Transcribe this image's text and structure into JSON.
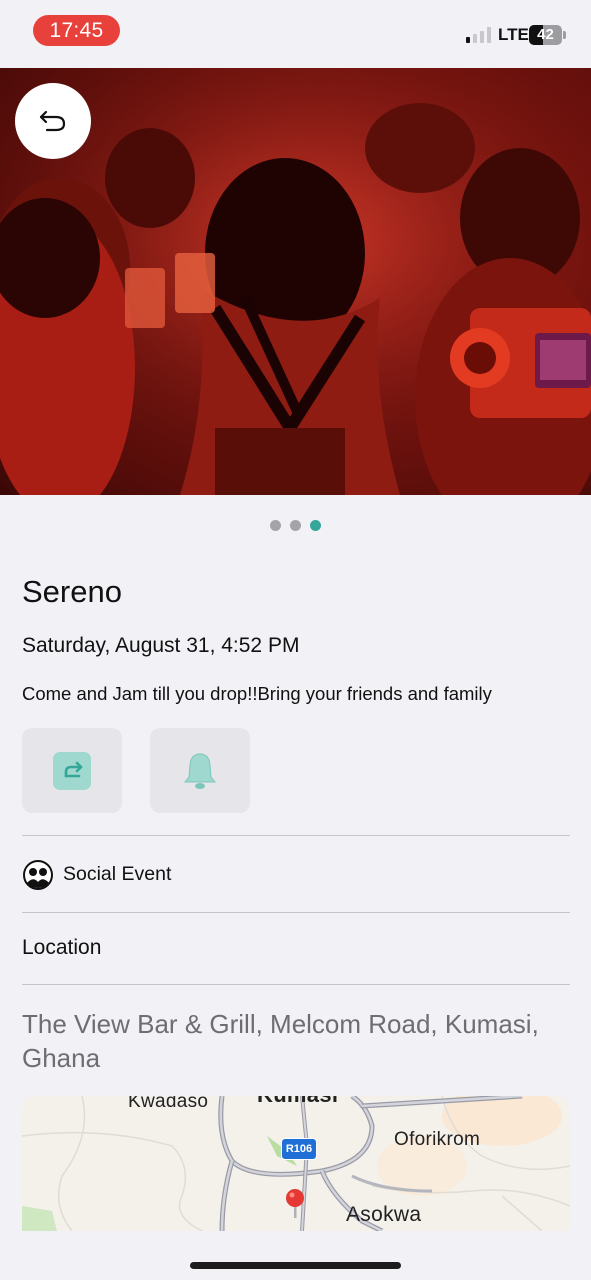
{
  "status_bar": {
    "time": "17:45",
    "network": "LTE",
    "battery_level": 42,
    "battery_label": "42",
    "signal_bars_active": 1,
    "signal_bars_total": 4
  },
  "hero": {
    "image_desc_icon": "crowd-photo",
    "back_icon": "undo-arrow-icon",
    "carousel_pages": 3,
    "carousel_active_index": 2
  },
  "event": {
    "title": "Sereno",
    "datetime": "Saturday, August 31, 4:52 PM",
    "description": "Come and Jam till you drop!!Bring your friends and family",
    "actions": [
      {
        "icon": "share-icon"
      },
      {
        "icon": "bell-icon"
      }
    ],
    "category": {
      "label": "Social Event",
      "icon": "people-icon"
    },
    "location_heading": "Location",
    "address": "The View Bar & Grill, Melcom Road, Kumasi, Ghana"
  },
  "map": {
    "labels": {
      "kwadaso": "Kwadaso",
      "kumasi": "Kumasi",
      "oforikrom": "Oforikrom",
      "asokwa": "Asokwa"
    },
    "road_badge": "R106",
    "pin_color": "#e53935"
  },
  "colors": {
    "accent": "#35a79a",
    "accent_light": "#9fd8cf",
    "time_pill": "#e8403a"
  }
}
